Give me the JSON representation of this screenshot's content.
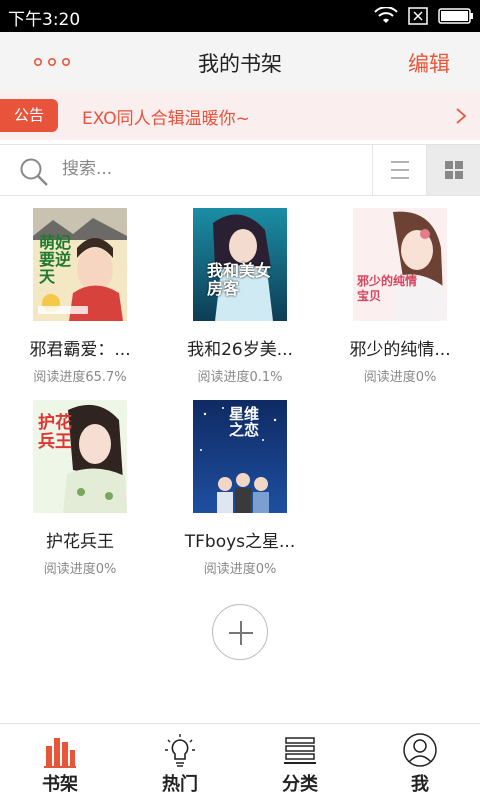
{
  "status_bar": {
    "time": "下午3:20"
  },
  "header": {
    "title": "我的书架",
    "edit_label": "编辑"
  },
  "notice": {
    "badge": "公告",
    "text": "EXO同人合辑温暖你~"
  },
  "search": {
    "placeholder": "搜索..."
  },
  "books": [
    {
      "title": "邪君霸爱：...",
      "progress": "阅读进度65.7%",
      "cover_text": "萌妃要逆天"
    },
    {
      "title": "我和26岁美...",
      "progress": "阅读进度0.1%",
      "cover_text": "我和美女房客"
    },
    {
      "title": "邪少的纯情...",
      "progress": "阅读进度0%",
      "cover_text": "邪少的纯情宝贝"
    },
    {
      "title": "护花兵王",
      "progress": "阅读进度0%",
      "cover_text": "护花兵王"
    },
    {
      "title": "TFboys之星...",
      "progress": "阅读进度0%",
      "cover_text": "星维之恋"
    }
  ],
  "bottom_nav": {
    "items": [
      {
        "label": "书架",
        "icon": "bookshelf-icon",
        "active": true
      },
      {
        "label": "热门",
        "icon": "lightbulb-icon",
        "active": false
      },
      {
        "label": "分类",
        "icon": "category-icon",
        "active": false
      },
      {
        "label": "我",
        "icon": "user-icon",
        "active": false
      }
    ]
  },
  "colors": {
    "accent": "#e8563a",
    "header_bg": "#f4f4f4",
    "notice_bg": "#fbeeee"
  }
}
